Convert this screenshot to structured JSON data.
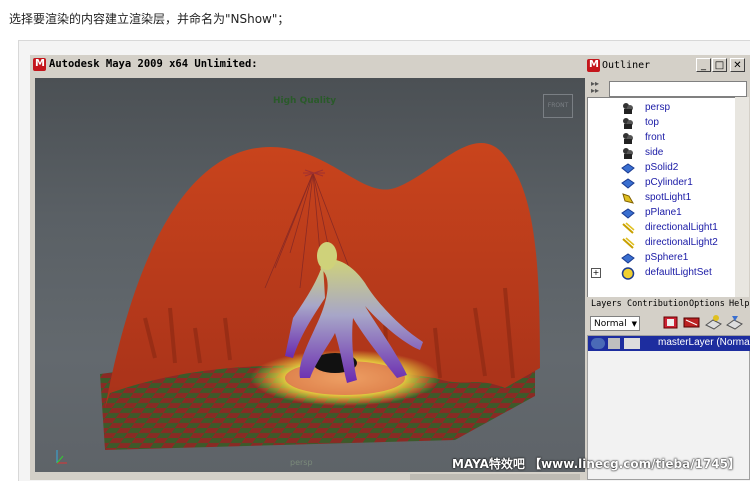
{
  "caption": "选择要渲染的内容建立渲染层，并命名为\"NShow\"；",
  "maya": {
    "title": "Autodesk Maya 2009 x64 Unlimited:",
    "viewport": {
      "quality_label": "High Quality",
      "camera_label": "persp",
      "cube_label": "FRONT"
    }
  },
  "outliner": {
    "title": "Outliner",
    "buttons": {
      "minimize": "_",
      "maximize": "□",
      "close": "✕"
    },
    "items": [
      {
        "label": "persp",
        "icon": "camera-icon"
      },
      {
        "label": "top",
        "icon": "camera-icon"
      },
      {
        "label": "front",
        "icon": "camera-icon"
      },
      {
        "label": "side",
        "icon": "camera-icon"
      },
      {
        "label": "pSolid2",
        "icon": "mesh-icon"
      },
      {
        "label": "pCylinder1",
        "icon": "mesh-icon"
      },
      {
        "label": "spotLight1",
        "icon": "spotlight-icon"
      },
      {
        "label": "pPlane1",
        "icon": "mesh-icon"
      },
      {
        "label": "directionalLight1",
        "icon": "directional-light-icon"
      },
      {
        "label": "directionalLight2",
        "icon": "directional-light-icon"
      },
      {
        "label": "pSphere1",
        "icon": "mesh-icon"
      },
      {
        "label": "defaultLightSet",
        "icon": "light-set-icon"
      }
    ]
  },
  "layers": {
    "menu": [
      "Layers",
      "Contribution",
      "Options",
      "Help"
    ],
    "mode": "Normal",
    "rows": [
      {
        "name": "masterLayer (Normal)"
      }
    ]
  },
  "watermark": "MAYA特效吧 【www.linecg.com/tieba/1745】",
  "colors": {
    "selection": "#1d2d9f",
    "outliner_text": "#1a1aa6",
    "maya_red": "#c4161c"
  }
}
